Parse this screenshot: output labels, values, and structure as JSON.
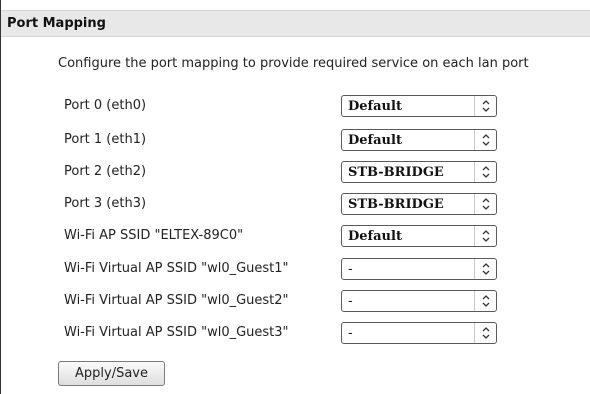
{
  "section": {
    "title": "Port Mapping",
    "description": "Configure the port mapping to provide required service on each lan port"
  },
  "mappings": [
    {
      "label": "Port 0 (eth0)",
      "value": "Default"
    },
    {
      "label": "Port 1 (eth1)",
      "value": "Default"
    },
    {
      "label": "Port 2 (eth2)",
      "value": "STB-BRIDGE"
    },
    {
      "label": "Port 3 (eth3)",
      "value": "STB-BRIDGE"
    },
    {
      "label": "Wi-Fi AP SSID \"ELTEX-89C0\"",
      "value": "Default"
    },
    {
      "label": "Wi-Fi Virtual AP SSID \"wl0_Guest1\"",
      "value": "-"
    },
    {
      "label": "Wi-Fi Virtual AP SSID \"wl0_Guest2\"",
      "value": "-"
    },
    {
      "label": "Wi-Fi Virtual AP SSID \"wl0_Guest3\"",
      "value": "-"
    }
  ],
  "actions": {
    "apply_label": "Apply/Save"
  },
  "icons": {
    "select_arrow": "up-down-chevron-icon"
  }
}
